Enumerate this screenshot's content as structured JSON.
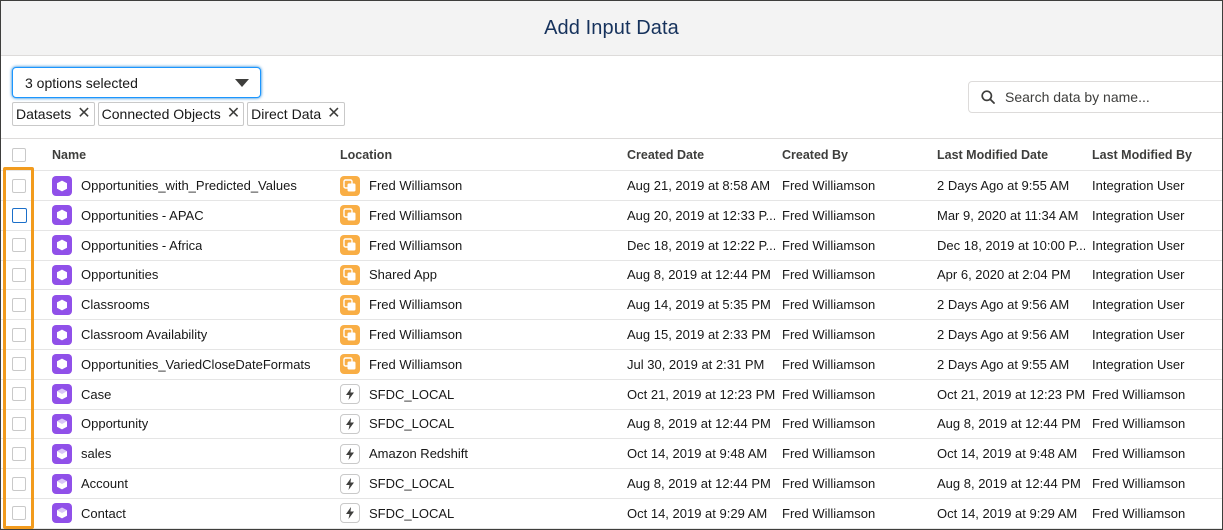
{
  "header": {
    "title": "Add Input Data"
  },
  "filter": {
    "summary": "3 options selected",
    "pills": [
      {
        "label": "Datasets"
      },
      {
        "label": "Connected Objects"
      },
      {
        "label": "Direct Data"
      }
    ],
    "remove_glyph": "✕"
  },
  "search": {
    "placeholder": "Search data by name...",
    "value": ""
  },
  "table": {
    "columns": [
      "Name",
      "Location",
      "Created Date",
      "Created By",
      "Last Modified Date",
      "Last Modified By"
    ],
    "rows": [
      {
        "icon": "dataset-icon",
        "name": "Opportunities_with_Predicted_Values",
        "loc_icon": "app-icon",
        "location": "Fred Williamson",
        "created_date": "Aug 21, 2019 at 8:58 AM",
        "created_by": "Fred Williamson",
        "last_modified_date": "2 Days Ago at 9:55 AM",
        "last_modified_by": "Integration User"
      },
      {
        "icon": "dataset-icon",
        "name": "Opportunities - APAC",
        "loc_icon": "app-icon",
        "location": "Fred Williamson",
        "created_date": "Aug 20, 2019 at 12:33 P...",
        "created_by": "Fred Williamson",
        "last_modified_date": "Mar 9, 2020 at 11:34 AM",
        "last_modified_by": "Integration User"
      },
      {
        "icon": "dataset-icon",
        "name": "Opportunities - Africa",
        "loc_icon": "app-icon",
        "location": "Fred Williamson",
        "created_date": "Dec 18, 2019 at 12:22 P...",
        "created_by": "Fred Williamson",
        "last_modified_date": "Dec 18, 2019 at 10:00 P...",
        "last_modified_by": "Integration User"
      },
      {
        "icon": "dataset-icon",
        "name": "Opportunities",
        "loc_icon": "app-icon",
        "location": "Shared App",
        "created_date": "Aug 8, 2019 at 12:44 PM",
        "created_by": "Fred Williamson",
        "last_modified_date": "Apr 6, 2020 at 2:04 PM",
        "last_modified_by": "Integration User"
      },
      {
        "icon": "dataset-icon",
        "name": "Classrooms",
        "loc_icon": "app-icon",
        "location": "Fred Williamson",
        "created_date": "Aug 14, 2019 at 5:35 PM",
        "created_by": "Fred Williamson",
        "last_modified_date": "2 Days Ago at 9:56 AM",
        "last_modified_by": "Integration User"
      },
      {
        "icon": "dataset-icon",
        "name": "Classroom Availability",
        "loc_icon": "app-icon",
        "location": "Fred Williamson",
        "created_date": "Aug 15, 2019 at 2:33 PM",
        "created_by": "Fred Williamson",
        "last_modified_date": "2 Days Ago at 9:56 AM",
        "last_modified_by": "Integration User"
      },
      {
        "icon": "dataset-icon",
        "name": "Opportunities_VariedCloseDateFormats",
        "loc_icon": "app-icon",
        "location": "Fred Williamson",
        "created_date": "Jul 30, 2019 at 2:31 PM",
        "created_by": "Fred Williamson",
        "last_modified_date": "2 Days Ago at 9:55 AM",
        "last_modified_by": "Integration User"
      },
      {
        "icon": "connected-object-icon",
        "name": "Case",
        "loc_icon": "connection-icon",
        "location": "SFDC_LOCAL",
        "created_date": "Oct 21, 2019 at 12:23 PM",
        "created_by": "Fred Williamson",
        "last_modified_date": "Oct 21, 2019 at 12:23 PM",
        "last_modified_by": "Fred Williamson"
      },
      {
        "icon": "connected-object-icon",
        "name": "Opportunity",
        "loc_icon": "connection-icon",
        "location": "SFDC_LOCAL",
        "created_date": "Aug 8, 2019 at 12:44 PM",
        "created_by": "Fred Williamson",
        "last_modified_date": "Aug 8, 2019 at 12:44 PM",
        "last_modified_by": "Fred Williamson"
      },
      {
        "icon": "connected-object-icon",
        "name": "sales",
        "loc_icon": "connection-icon",
        "location": "Amazon Redshift",
        "created_date": "Oct 14, 2019 at 9:48 AM",
        "created_by": "Fred Williamson",
        "last_modified_date": "Oct 14, 2019 at 9:48 AM",
        "last_modified_by": "Fred Williamson"
      },
      {
        "icon": "connected-object-icon",
        "name": "Account",
        "loc_icon": "connection-icon",
        "location": "SFDC_LOCAL",
        "created_date": "Aug 8, 2019 at 12:44 PM",
        "created_by": "Fred Williamson",
        "last_modified_date": "Aug 8, 2019 at 12:44 PM",
        "last_modified_by": "Fred Williamson"
      },
      {
        "icon": "connected-object-icon",
        "name": "Contact",
        "loc_icon": "connection-icon",
        "location": "SFDC_LOCAL",
        "created_date": "Oct 14, 2019 at 9:29 AM",
        "created_by": "Fred Williamson",
        "last_modified_date": "Oct 14, 2019 at 9:29 AM",
        "last_modified_by": "Fred Williamson"
      }
    ]
  },
  "colors": {
    "dataset_icon": "#9050e9",
    "app_icon": "#f9ae45",
    "highlight": "#f29b1d",
    "focus": "#1b96ff"
  }
}
